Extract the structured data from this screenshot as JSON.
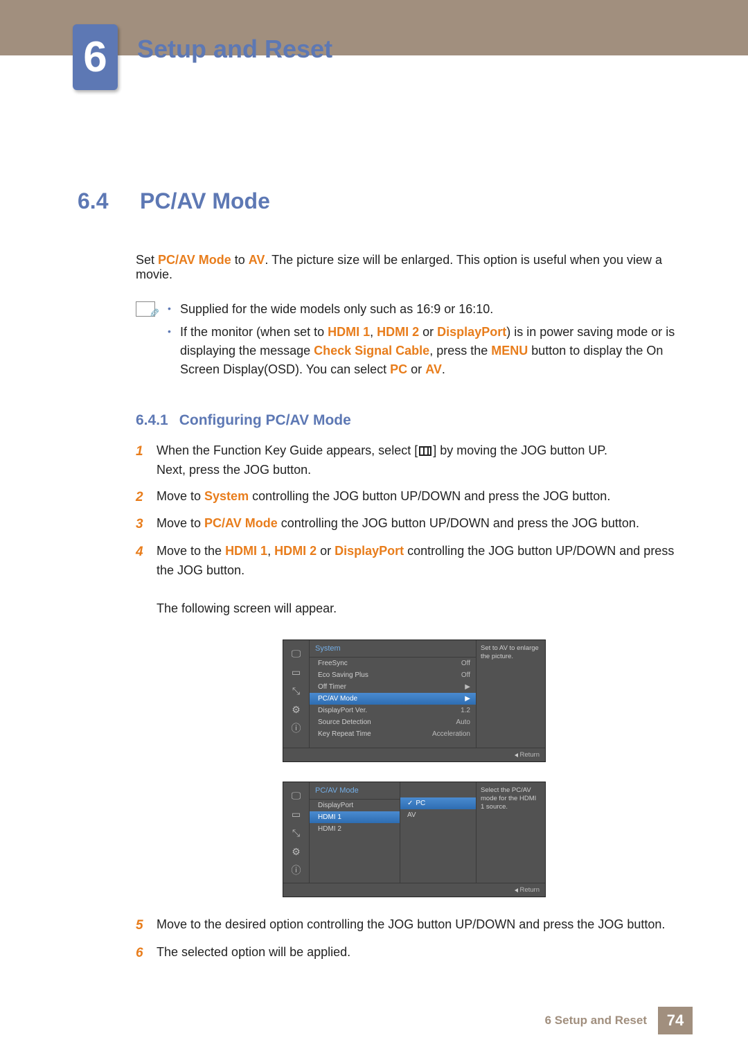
{
  "chapter": {
    "number": "6",
    "title": "Setup and Reset"
  },
  "section": {
    "number": "6.4",
    "title": "PC/AV Mode"
  },
  "intro": {
    "p1_a": "Set ",
    "p1_b": "PC/AV Mode",
    "p1_c": " to ",
    "p1_d": "AV",
    "p1_e": ". The picture size will be enlarged. This option is useful when you view a movie."
  },
  "notes": {
    "n1": "Supplied for the wide models only such as 16:9 or 16:10.",
    "n2_a": "If the monitor (when set to ",
    "n2_b": "HDMI 1",
    "n2_c": ", ",
    "n2_d": "HDMI 2",
    "n2_e": " or ",
    "n2_f": "DisplayPort",
    "n2_g": ") is in power saving mode or is displaying the message ",
    "n2_h": "Check Signal Cable",
    "n2_i": ", press the ",
    "n2_j": "MENU",
    "n2_k": " button to display the On Screen Display(OSD). You can select ",
    "n2_l": "PC",
    "n2_m": " or ",
    "n2_n": "AV",
    "n2_o": "."
  },
  "subsection": {
    "number": "6.4.1",
    "title": "Configuring PC/AV Mode"
  },
  "steps": {
    "s1_a": "When the Function Key Guide appears, select [",
    "s1_b": "] by moving the JOG button UP.",
    "s1_c": "Next, press the JOG button.",
    "s2_a": "Move to ",
    "s2_b": "System",
    "s2_c": " controlling the JOG button UP/DOWN and press the JOG button.",
    "s3_a": "Move to ",
    "s3_b": "PC/AV Mode",
    "s3_c": " controlling the JOG button UP/DOWN and press the JOG button.",
    "s4_a": "Move to the ",
    "s4_b": "HDMI 1",
    "s4_c": ", ",
    "s4_d": "HDMI 2",
    "s4_e": " or ",
    "s4_f": "DisplayPort",
    "s4_g": " controlling the JOG button UP/DOWN and press the JOG button.",
    "s4_h": "The following screen will appear.",
    "s5": "Move to the desired option controlling the JOG button UP/DOWN and press the JOG button.",
    "s6": "The selected option will be applied."
  },
  "osd1": {
    "title": "System",
    "help": "Set to AV to enlarge the picture.",
    "return": "Return",
    "rows": [
      {
        "label": "FreeSync",
        "val": "Off"
      },
      {
        "label": "Eco Saving Plus",
        "val": "Off"
      },
      {
        "label": "Off Timer",
        "val": "▶"
      },
      {
        "label": "PC/AV Mode",
        "val": "▶",
        "sel": "1"
      },
      {
        "label": "DisplayPort Ver.",
        "val": "1.2"
      },
      {
        "label": "Source Detection",
        "val": "Auto"
      },
      {
        "label": "Key Repeat Time",
        "val": "Acceleration"
      }
    ]
  },
  "osd2": {
    "title": "PC/AV Mode",
    "help": "Select the PC/AV mode for the HDMI 1 source.",
    "return": "Return",
    "items": [
      {
        "label": "DisplayPort"
      },
      {
        "label": "HDMI 1",
        "sel": "1"
      },
      {
        "label": "HDMI 2"
      }
    ],
    "opts": [
      {
        "label": "PC",
        "sel": "1"
      },
      {
        "label": "AV"
      }
    ]
  },
  "footer": {
    "label": "6 Setup and Reset",
    "page": "74"
  },
  "step_nums": {
    "n1": "1",
    "n2": "2",
    "n3": "3",
    "n4": "4",
    "n5": "5",
    "n6": "6"
  }
}
